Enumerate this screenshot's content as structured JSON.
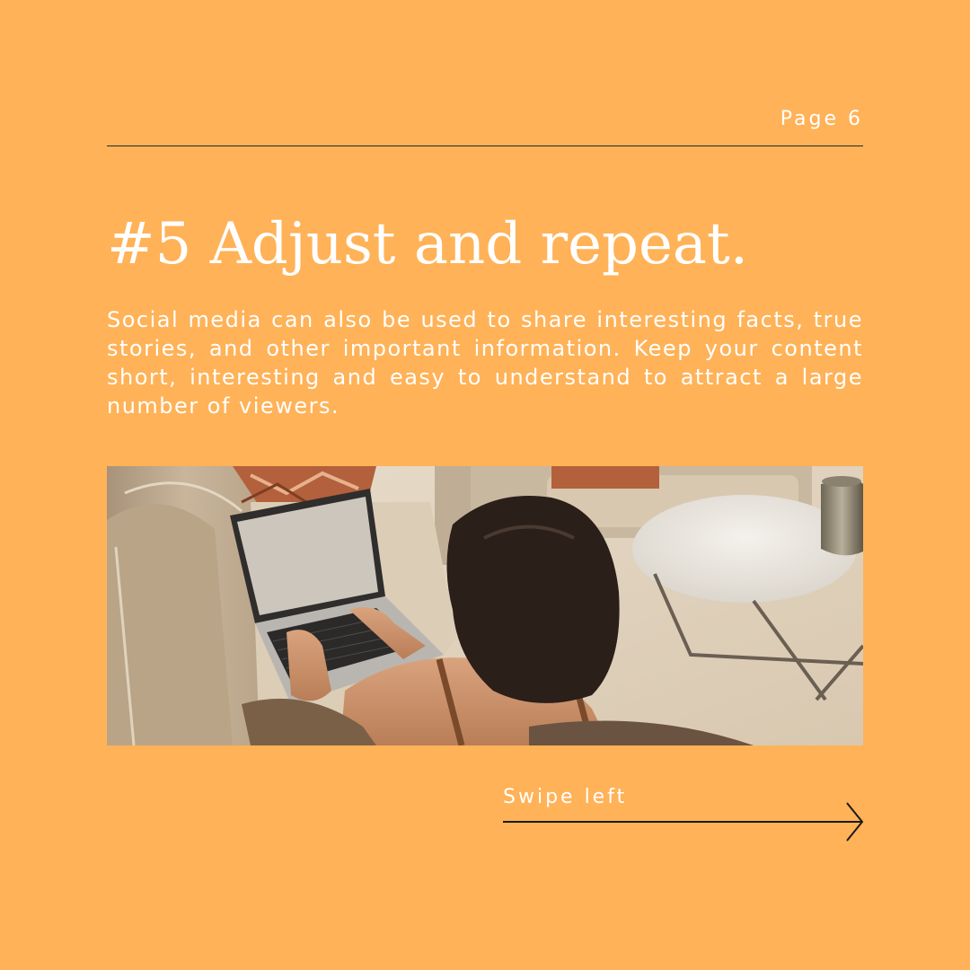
{
  "header": {
    "page_label": "Page 6"
  },
  "content": {
    "headline": "#5 Adjust and repeat.",
    "body": "Social media can also be used to share interesting facts, true stories, and other important information. Keep your content short, interesting and easy to understand to attract a large number of viewers."
  },
  "footer": {
    "swipe_label": "Swipe left"
  },
  "colors": {
    "background": "#FFB257",
    "text": "#FFFFFF",
    "rule": "#2A2A2A"
  },
  "icons": {
    "swipe_arrow": "arrow-right-icon"
  }
}
